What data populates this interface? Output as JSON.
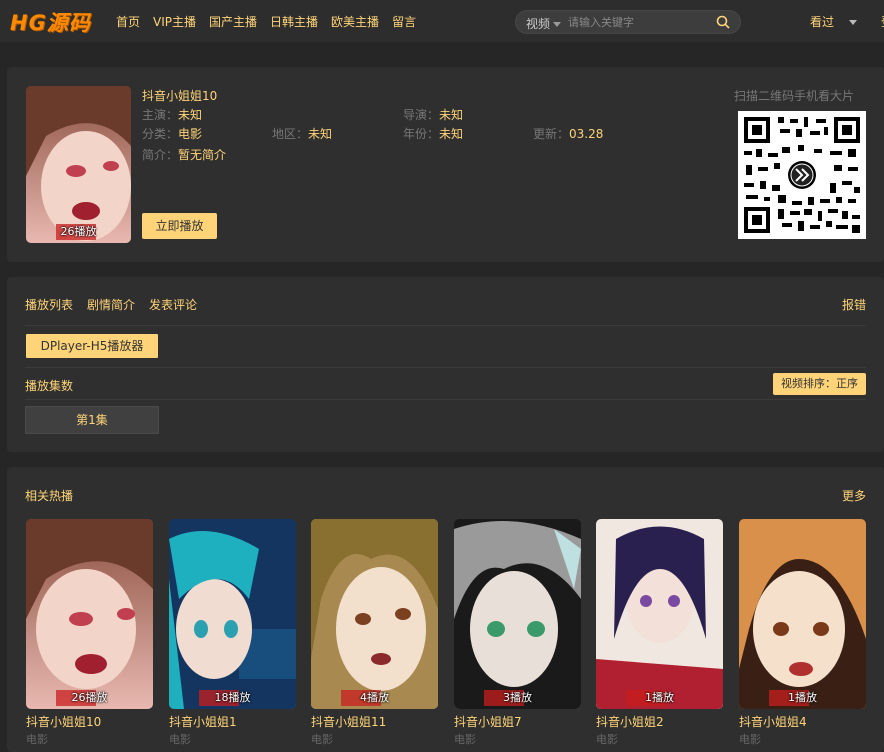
{
  "header": {
    "logo": "HG源码",
    "nav": [
      "首页",
      "VIP主播",
      "国产主播",
      "日韩主播",
      "欧美主播",
      "留言"
    ],
    "search_type": "视频",
    "search_placeholder": "请输入关键字",
    "history": "看过",
    "login": "登录"
  },
  "detail": {
    "title": "抖音小姐姐10",
    "play_count": "26播放",
    "actor_label": "主演：",
    "actor": "未知",
    "director_label": "导演：",
    "director": "未知",
    "category_label": "分类：",
    "category": "电影",
    "region_label": "地区：",
    "region": "未知",
    "year_label": "年份：",
    "year": "未知",
    "update_label": "更新：",
    "update": "03.28",
    "intro_label": "简介：",
    "intro": "暂无简介",
    "play_button": "立即播放",
    "qr_title": "扫描二维码手机看大片"
  },
  "playlist": {
    "tabs": [
      "播放列表",
      "剧情简介",
      "发表评论"
    ],
    "report": "报错",
    "player": "DPlayer-H5播放器",
    "episodes_label": "播放集数",
    "sort": "视频排序：正序",
    "episodes": [
      "第1集"
    ]
  },
  "related": {
    "title": "相关热播",
    "more": "更多",
    "items": [
      {
        "title": "抖音小姐姐10",
        "type": "电影",
        "count": "26播放",
        "colors": [
          "#e8b8b0",
          "#8a5040"
        ]
      },
      {
        "title": "抖音小姐姐1",
        "type": "电影",
        "count": "18播放",
        "colors": [
          "#2ab3c8",
          "#1a3a6a"
        ]
      },
      {
        "title": "抖音小姐姐11",
        "type": "电影",
        "count": "4播放",
        "colors": [
          "#f0dcc0",
          "#9a7a3a"
        ]
      },
      {
        "title": "抖音小姐姐7",
        "type": "电影",
        "count": "3播放",
        "colors": [
          "#c8c8c8",
          "#303030"
        ]
      },
      {
        "title": "抖音小姐姐2",
        "type": "电影",
        "count": "1播放",
        "colors": [
          "#f0e0d0",
          "#2a2050"
        ]
      },
      {
        "title": "抖音小姐姐4",
        "type": "电影",
        "count": "1播放",
        "colors": [
          "#e8a060",
          "#4a2a1a"
        ]
      }
    ]
  },
  "colors": {
    "accent": "#ffd479",
    "logo": "#ff8a00",
    "background": "#262626",
    "panel": "#2f2f2f"
  }
}
